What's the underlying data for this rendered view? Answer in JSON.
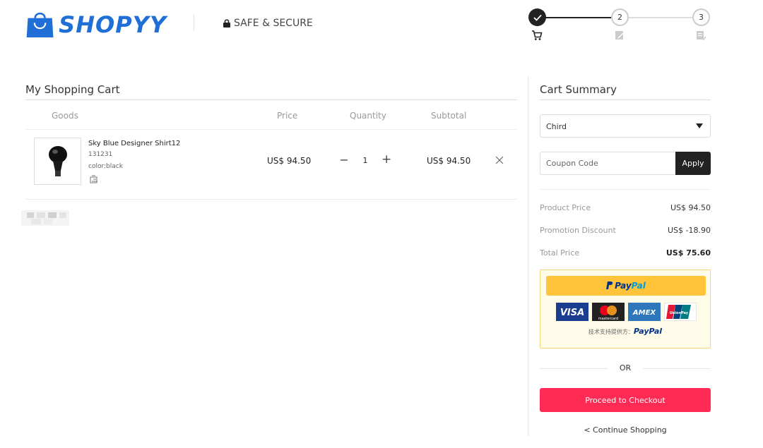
{
  "header": {
    "logo_text": "SHOPYY",
    "secure_label": "SAFE & SECURE",
    "steps": [
      {
        "label": "",
        "state": "done"
      },
      {
        "label": "2",
        "state": "pending"
      },
      {
        "label": "3",
        "state": "pending"
      }
    ]
  },
  "cart": {
    "title": "My Shopping Cart",
    "columns": {
      "goods": "Goods",
      "price": "Price",
      "quantity": "Quantity",
      "subtotal": "Subtotal"
    },
    "items": [
      {
        "name": "Sky Blue Designer Shirt12",
        "sku": "131231",
        "color": "color:black",
        "price": "US$ 94.50",
        "quantity": "1",
        "subtotal": "US$ 94.50"
      }
    ]
  },
  "summary": {
    "title": "Cart Summary",
    "country": "Chird",
    "coupon_placeholder": "Coupon Code",
    "apply_label": "Apply",
    "product_price_label": "Product Price",
    "product_price": "US$ 94.50",
    "discount_label": "Promotion Discount",
    "discount": "US$ -18.90",
    "total_label": "Total Price",
    "total": "US$ 75.60",
    "paypal": {
      "button_pay": "Pay",
      "button_pal": "Pal",
      "cards": [
        "VISA",
        "mastercard",
        "AMEX",
        "UnionPay"
      ],
      "powered_prefix": "技术支持提供方：",
      "powered_logo": "PayPal"
    },
    "or_label": "OR",
    "checkout_label": "Proceed to Checkout",
    "continue_label": "< Continue Shopping"
  },
  "colors": {
    "brand": "#1f6fd6",
    "checkout": "#ff2b55",
    "paypal_yellow": "#ffc43a"
  }
}
